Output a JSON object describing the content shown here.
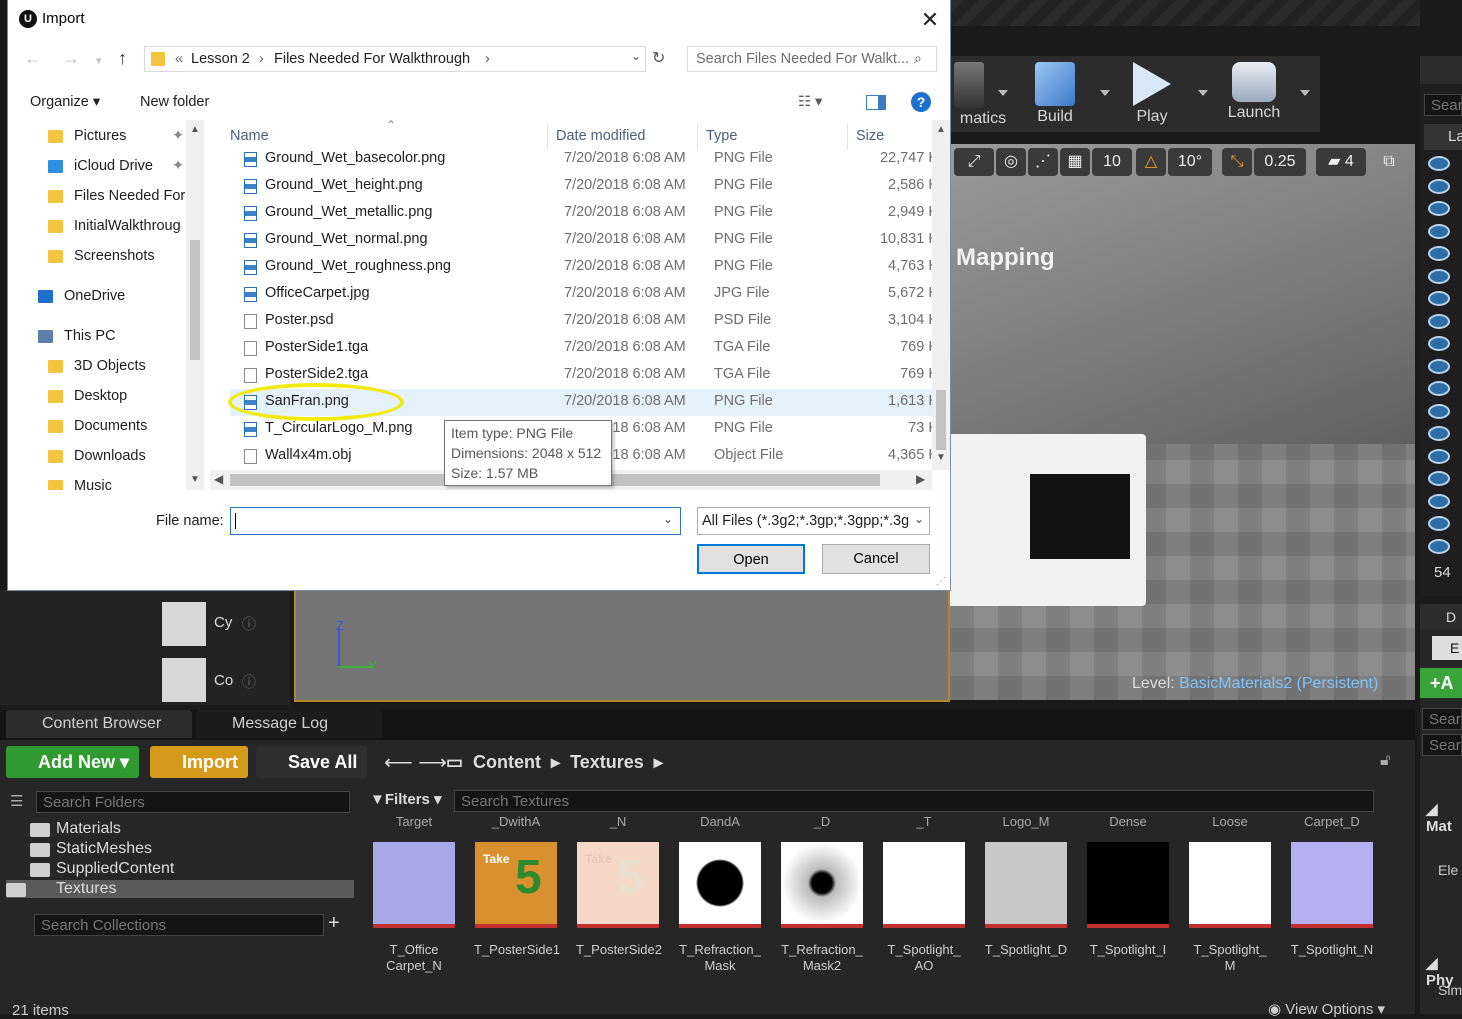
{
  "dialog": {
    "title": "Import",
    "logo": "U",
    "address": {
      "overflow": "«",
      "segments": [
        "Lesson 2",
        "Files Needed For Walkthrough"
      ]
    },
    "search_placeholder": "Search Files Needed For Walkt...",
    "commands": {
      "organize": "Organize ▾",
      "new_folder": "New folder"
    },
    "nav_items": [
      {
        "label": "Pictures",
        "icon": "folder-icon",
        "pinned": true
      },
      {
        "label": "iCloud Drive",
        "icon": "cloud-icon",
        "pinned": true
      },
      {
        "label": "Files Needed For",
        "icon": "folder-icon"
      },
      {
        "label": "InitialWalkthroug",
        "icon": "folder-icon"
      },
      {
        "label": "Screenshots",
        "icon": "folder-icon"
      },
      {
        "label": "OneDrive",
        "icon": "onedrive-icon"
      },
      {
        "label": "This PC",
        "icon": "computer-icon"
      },
      {
        "label": "3D Objects",
        "icon": "folder-icon"
      },
      {
        "label": "Desktop",
        "icon": "folder-icon"
      },
      {
        "label": "Documents",
        "icon": "folder-icon"
      },
      {
        "label": "Downloads",
        "icon": "folder-icon"
      },
      {
        "label": "Music",
        "icon": "folder-icon"
      }
    ],
    "columns": [
      "Name",
      "Date modified",
      "Type",
      "Size"
    ],
    "files": [
      {
        "name": "Ground_Wet_basecolor.png",
        "date": "7/20/2018 6:08 AM",
        "type": "PNG File",
        "size": "22,747 K",
        "icon": "image"
      },
      {
        "name": "Ground_Wet_height.png",
        "date": "7/20/2018 6:08 AM",
        "type": "PNG File",
        "size": "2,586 K",
        "icon": "image"
      },
      {
        "name": "Ground_Wet_metallic.png",
        "date": "7/20/2018 6:08 AM",
        "type": "PNG File",
        "size": "2,949 K",
        "icon": "image"
      },
      {
        "name": "Ground_Wet_normal.png",
        "date": "7/20/2018 6:08 AM",
        "type": "PNG File",
        "size": "10,831 K",
        "icon": "image"
      },
      {
        "name": "Ground_Wet_roughness.png",
        "date": "7/20/2018 6:08 AM",
        "type": "PNG File",
        "size": "4,763 K",
        "icon": "image"
      },
      {
        "name": "OfficeCarpet.jpg",
        "date": "7/20/2018 6:08 AM",
        "type": "JPG File",
        "size": "5,672 K",
        "icon": "image"
      },
      {
        "name": "Poster.psd",
        "date": "7/20/2018 6:08 AM",
        "type": "PSD File",
        "size": "3,104 K",
        "icon": "file"
      },
      {
        "name": "PosterSide1.tga",
        "date": "7/20/2018 6:08 AM",
        "type": "TGA File",
        "size": "769 K",
        "icon": "file"
      },
      {
        "name": "PosterSide2.tga",
        "date": "7/20/2018 6:08 AM",
        "type": "TGA File",
        "size": "769 K",
        "icon": "file"
      },
      {
        "name": "SanFran.png",
        "date": "7/20/2018 6:08 AM",
        "type": "PNG File",
        "size": "1,613 K",
        "icon": "image",
        "selected": true
      },
      {
        "name": "T_CircularLogo_M.png",
        "date": "7/20/2018 6:08 AM",
        "type": "PNG File",
        "size": "73 K",
        "icon": "image"
      },
      {
        "name": "Wall4x4m.obj",
        "date": "7/20/2018 6:08 AM",
        "type": "Object File",
        "size": "4,365 K",
        "icon": "obj"
      }
    ],
    "tooltip": [
      "Item type: PNG File",
      "Dimensions: 2048 x 512",
      "Size: 1.57 MB"
    ],
    "file_name_label": "File name:",
    "file_name_value": "",
    "filter": "All Files (*.3g2;*.3gp;*.3gpp;*.3g",
    "open": "Open",
    "cancel": "Cancel"
  },
  "editor": {
    "toolbar": [
      "matics",
      "Build",
      "Play",
      "Launch"
    ],
    "viewport_tools": [
      "10",
      "10°",
      "0.25",
      "4"
    ],
    "viewport_text": "Mapping",
    "level_label": "Level:",
    "level_value": "BasicMaterials2 (Persistent)",
    "axis": [
      "Z",
      "Y"
    ],
    "outliner_count": "54",
    "outliner_search": "Sear",
    "outliner_header": "La",
    "details": {
      "tab": "D",
      "add": "A",
      "search1": "Sear",
      "search2": "Sear",
      "section1": "Mat",
      "row": "Ele",
      "section2": "Phy",
      "row2": "Sim"
    },
    "modes_items": [
      "Cy",
      "Co"
    ]
  },
  "content_browser": {
    "tabs": [
      "Content Browser",
      "Message Log"
    ],
    "add_new": "Add New",
    "import": "Import",
    "save_all": "Save All",
    "path": [
      "Content",
      "Textures"
    ],
    "search_folders": "Search Folders",
    "filters": "Filters",
    "search_assets": "Search Textures",
    "folders": [
      "Materials",
      "StaticMeshes",
      "SuppliedContent",
      "Textures"
    ],
    "search_collections": "Search Collections",
    "top_labels": [
      "Target",
      "_DwithA",
      "_N",
      "DandA",
      "_D",
      "_T",
      "Logo_M",
      "Dense",
      "Loose",
      "Carpet_D"
    ],
    "assets": [
      {
        "name": "T_Office Carpet_N",
        "thumb": "#a8a8e6"
      },
      {
        "name": "T_PosterSide1",
        "thumb": "#d9912f"
      },
      {
        "name": "T_PosterSide2",
        "thumb": "#f4d9c8"
      },
      {
        "name": "T_Refraction_ Mask",
        "thumb": "#ffffff"
      },
      {
        "name": "T_Refraction_ Mask2",
        "thumb": "#f5f5f5"
      },
      {
        "name": "T_Spotlight_ AO",
        "thumb": "#ffffff"
      },
      {
        "name": "T_Spotlight_D",
        "thumb": "#c8c8c8"
      },
      {
        "name": "T_Spotlight_I",
        "thumb": "#000000"
      },
      {
        "name": "T_Spotlight_ M",
        "thumb": "#ffffff"
      },
      {
        "name": "T_Spotlight_N",
        "thumb": "#b6b0f0"
      }
    ],
    "poster_number": "5",
    "poster_word": "Take",
    "item_count": "21 items",
    "view_options": "View Options"
  }
}
